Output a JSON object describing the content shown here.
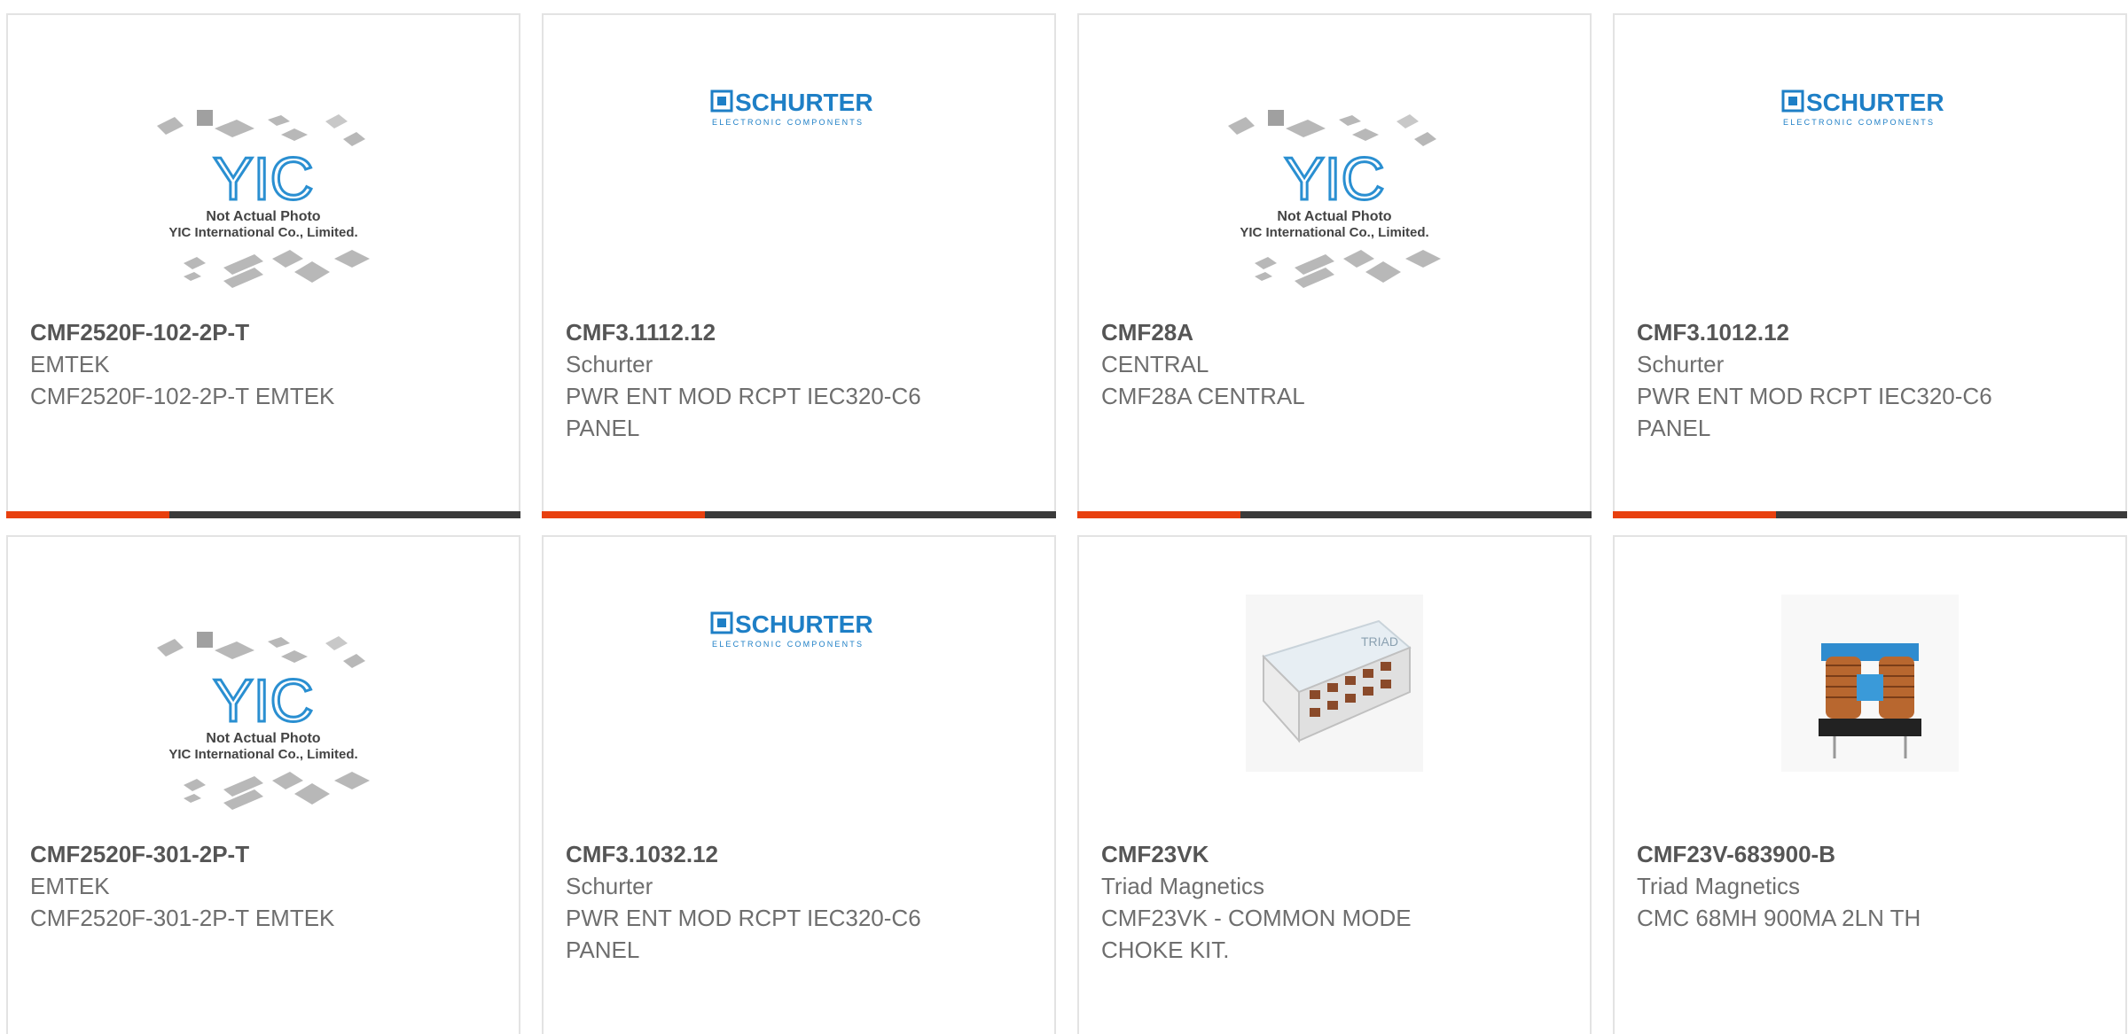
{
  "products": [
    {
      "part": "CMF2520F-102-2P-T",
      "maker": "EMTEK",
      "desc": "CMF2520F-102-2P-T EMTEK",
      "image": "yic-placeholder"
    },
    {
      "part": "CMF3.1112.12",
      "maker": "Schurter",
      "desc": "PWR ENT MOD RCPT IEC320-C6 PANEL",
      "image": "schurter-logo"
    },
    {
      "part": "CMF28A",
      "maker": "CENTRAL",
      "desc": "CMF28A CENTRAL",
      "image": "yic-placeholder"
    },
    {
      "part": "CMF3.1012.12",
      "maker": "Schurter",
      "desc": "PWR ENT MOD RCPT IEC320-C6 PANEL",
      "image": "schurter-logo"
    },
    {
      "part": "CMF2520F-301-2P-T",
      "maker": "EMTEK",
      "desc": "CMF2520F-301-2P-T EMTEK",
      "image": "yic-placeholder"
    },
    {
      "part": "CMF3.1032.12",
      "maker": "Schurter",
      "desc": "PWR ENT MOD RCPT IEC320-C6 PANEL",
      "image": "schurter-logo"
    },
    {
      "part": "CMF23VK",
      "maker": "Triad Magnetics",
      "desc": "CMF23VK - COMMON MODE CHOKE KIT.",
      "image": "choke-kit-photo"
    },
    {
      "part": "CMF23V-683900-B",
      "maker": "Triad Magnetics",
      "desc": "CMC 68MH 900MA 2LN TH",
      "image": "choke-photo"
    }
  ],
  "yic": {
    "brand": "YIC",
    "line1": "Not Actual Photo",
    "line2": "YIC International Co., Limited."
  },
  "schurter": {
    "brand": "SCHURTER",
    "tagline": "ELECTRONIC COMPONENTS"
  },
  "triad": {
    "brand": "TRIAD"
  },
  "colors": {
    "accent": "#e8400f",
    "bar": "#3a3a3a",
    "schurter_blue": "#1e7fc6",
    "yic_blue": "#2a8fd1"
  }
}
